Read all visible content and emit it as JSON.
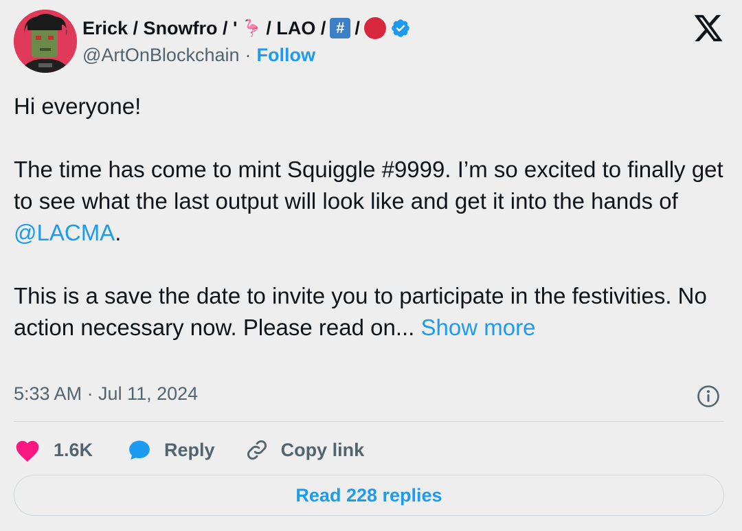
{
  "author": {
    "name_parts": [
      "Erick / Snowfro / '",
      "/ LAO /",
      "/"
    ],
    "flamingo": "🦩",
    "hash_badge": "#",
    "handle": "@ArtOnBlockchain",
    "separator": "·",
    "follow_label": "Follow",
    "verified_color": "#1d9bf0"
  },
  "tweet": {
    "line1": "Hi everyone!",
    "para2_before": "The time has come to mint Squiggle #9999. I’m so excited to finally get to see what the last output will look like and get it into the hands of ",
    "mention": "@LACMA",
    "para2_after": ".",
    "para3": "This is a save the date to invite you to participate in the festivities. No action necessary now. Please read on... ",
    "show_more": "Show more",
    "timestamp": "5:33 AM · Jul 11, 2024"
  },
  "actions": {
    "likes": "1.6K",
    "reply_label": "Reply",
    "copy_label": "Copy link"
  },
  "footer": {
    "read_replies": "Read 228 replies"
  },
  "colors": {
    "accent": "#1d9bf0",
    "like": "#f91880",
    "background": "#eeeeee"
  }
}
